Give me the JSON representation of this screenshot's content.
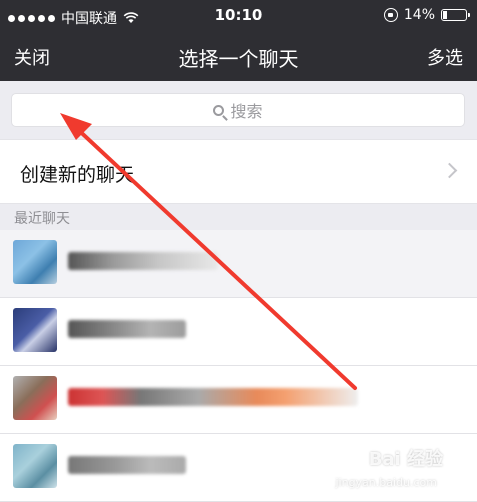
{
  "statusbar": {
    "carrier": "中国联通",
    "time": "10:10",
    "battery": "14%",
    "signal_dots": 5,
    "battery_level": 0.14,
    "icons": [
      "signal-icon",
      "wifi-icon",
      "rotation-lock-icon",
      "battery-icon"
    ]
  },
  "navbar": {
    "left": "关闭",
    "title": "选择一个聊天",
    "right": "多选"
  },
  "search": {
    "placeholder": "搜索",
    "icon": "search-icon"
  },
  "new_chat": {
    "label": "创建新的聊天",
    "icon": "chevron-right-icon"
  },
  "section": {
    "recent": "最近聊天"
  },
  "recent_chats": [
    {
      "name": ""
    },
    {
      "name": ""
    },
    {
      "name": ""
    },
    {
      "name": ""
    }
  ],
  "watermark": {
    "brand": "Bai 经验",
    "sub": "jingyan.baidu.com"
  },
  "colors": {
    "header_bg": "#2e2e33",
    "page_bg": "#ececf1",
    "annotation_arrow": "#f03a2e"
  }
}
